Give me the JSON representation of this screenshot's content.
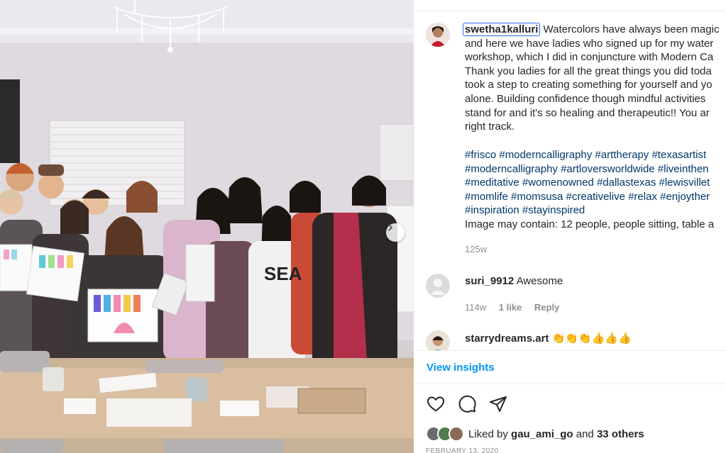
{
  "post": {
    "username": "swetha1kalluri",
    "caption_lines": [
      " Watercolors have always been magic",
      "and here we have ladies who signed up for my water",
      "workshop, which I did in conjuncture with Modern Ca",
      "Thank you ladies for all the great things you did toda",
      "took a step to creating something for yourself and yo",
      "alone. Building confidence though mindful activities",
      "stand for and it's so healing and therapeutic!! You ar",
      "right track."
    ],
    "hashtag_lines": [
      "#frisco #moderncalligraphy #arttherapy #texasartist",
      "#moderncalligraphy #artloversworldwide #liveinthen",
      "#meditative #womenowned #dallastexas #lewisvillet",
      "#momlife #momsusa #creativelive #relax #enjoyther",
      "#inspiration #stayinspired"
    ],
    "image_description": "Image may contain: 12 people, people sitting, table a",
    "time_ago": "125w"
  },
  "comments": [
    {
      "username": "suri_9912",
      "text": "Awesome",
      "time": "114w",
      "likes": "1 like",
      "reply": "Reply"
    },
    {
      "username": "starrydreams.art",
      "text": "👏👏👏👍👍👍",
      "time": "",
      "likes": "",
      "reply": ""
    }
  ],
  "insights_label": "View insights",
  "liked_by": {
    "prefix": "Liked by ",
    "user": "gau_ami_go",
    "middle": " and ",
    "others": "33 others"
  },
  "date": "FEBRUARY 13, 2020",
  "icons": {
    "like": "heart-icon",
    "comment": "comment-icon",
    "share": "share-icon",
    "next": "chevron-right-icon"
  },
  "colors": {
    "link": "#00376b",
    "accent": "#0095f6",
    "muted": "#8e8e8e",
    "focus": "#2b6ef2"
  }
}
